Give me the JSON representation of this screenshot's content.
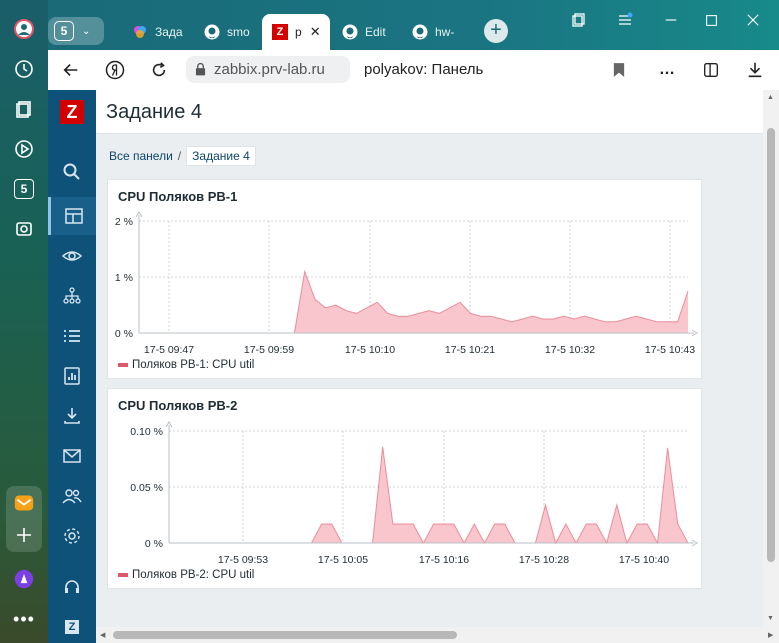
{
  "browser": {
    "tabs": [
      {
        "label": "Зада",
        "icon": "colorful-app-icon"
      },
      {
        "label": "smo",
        "icon": "github-icon"
      },
      {
        "label": "p",
        "icon": "zabbix-icon",
        "active": true
      },
      {
        "label": "Edit",
        "icon": "github-icon"
      },
      {
        "label": "hw-",
        "icon": "github-icon"
      }
    ],
    "tab_group_badge": "5",
    "url": "zabbix.prv-lab.ru",
    "page_title": "polyakov: Панель",
    "side_badge": "5"
  },
  "zabbix": {
    "logo": "Z",
    "dashboard_title": "Задание 4",
    "breadcrumb": {
      "all": "Все панели",
      "sep": "/",
      "current": "Задание 4"
    },
    "footer_logo": "Z"
  },
  "colors": {
    "series": "#e0566b",
    "fill": "#f9c6cd",
    "sidebar": "#0e5179"
  },
  "chart_data": [
    {
      "type": "area",
      "title": "CPU Поляков РВ-1",
      "y_ticks": [
        "2 %",
        "1 %",
        "0 %"
      ],
      "ylim": [
        0,
        2
      ],
      "x_ticks": [
        "17-5 09:47",
        "17-5 09:59",
        "17-5 10:10",
        "17-5 10:21",
        "17-5 10:32",
        "17-5 10:43"
      ],
      "series": [
        {
          "name": "Поляков РВ-1: CPU util",
          "values": [
            0,
            0,
            0,
            0,
            0,
            0,
            0,
            0,
            0,
            0,
            0,
            0,
            0,
            0,
            0,
            0,
            1.1,
            0.6,
            0.45,
            0.5,
            0.4,
            0.35,
            0.45,
            0.55,
            0.35,
            0.3,
            0.3,
            0.35,
            0.4,
            0.35,
            0.45,
            0.55,
            0.35,
            0.3,
            0.3,
            0.25,
            0.2,
            0.25,
            0.3,
            0.25,
            0.25,
            0.3,
            0.25,
            0.3,
            0.25,
            0.2,
            0.2,
            0.25,
            0.3,
            0.25,
            0.2,
            0.2,
            0.2,
            0.75
          ]
        }
      ],
      "grid": true
    },
    {
      "type": "area",
      "title": "CPU Поляков РВ-2",
      "y_ticks": [
        "0.10 %",
        "0.05 %",
        "0 %"
      ],
      "ylim": [
        0,
        0.1
      ],
      "x_ticks": [
        "17-5 09:53",
        "17-5 10:05",
        "17-5 10:16",
        "17-5 10:28",
        "17-5 10:40"
      ],
      "series": [
        {
          "name": "Поляков РВ-2: CPU util",
          "values": [
            0,
            0,
            0,
            0,
            0,
            0,
            0,
            0,
            0,
            0,
            0,
            0,
            0,
            0,
            0,
            0.017,
            0.017,
            0,
            0,
            0,
            0,
            0.086,
            0.017,
            0.017,
            0.017,
            0,
            0.017,
            0.017,
            0.017,
            0,
            0.017,
            0,
            0.017,
            0.017,
            0,
            0,
            0,
            0.034,
            0,
            0.017,
            0,
            0.017,
            0.017,
            0,
            0.034,
            0,
            0.017,
            0.017,
            0,
            0.085,
            0.017,
            0
          ]
        }
      ],
      "grid": true
    }
  ]
}
